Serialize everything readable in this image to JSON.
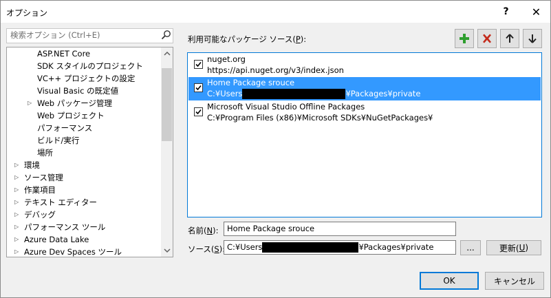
{
  "window": {
    "title": "オプション",
    "help": "?",
    "close": "✕"
  },
  "search": {
    "placeholder": "検索オプション (Ctrl+E)"
  },
  "tree": {
    "items": [
      {
        "label": "ASP.NET Core"
      },
      {
        "label": "SDK スタイルのプロジェクト"
      },
      {
        "label": "VC++ プロジェクトの設定"
      },
      {
        "label": "Visual Basic の既定値"
      },
      {
        "label": "Web パッケージ管理"
      },
      {
        "label": "Web プロジェクト"
      },
      {
        "label": "パフォーマンス"
      },
      {
        "label": "ビルド/実行"
      },
      {
        "label": "場所"
      },
      {
        "label": "環境"
      },
      {
        "label": "ソース管理"
      },
      {
        "label": "作業項目"
      },
      {
        "label": "テキスト エディター"
      },
      {
        "label": "デバッグ"
      },
      {
        "label": "パフォーマンス ツール"
      },
      {
        "label": "Azure Data Lake"
      },
      {
        "label": "Azure Dev Spaces ツール"
      }
    ]
  },
  "sources_panel": {
    "label_prefix": "利用可能なパッケージ ソース(",
    "label_key": "P",
    "label_suffix": "):",
    "items": [
      {
        "name": "nuget.org",
        "url": "https://api.nuget.org/v3/index.json",
        "url_tail": "",
        "checked": true
      },
      {
        "name": "Home Package srouce",
        "url": "C:¥Users",
        "url_tail": "¥Packages¥private",
        "checked": true
      },
      {
        "name": "Microsoft Visual Studio Offline Packages",
        "url": "C:¥Program Files (x86)¥Microsoft SDKs¥NuGetPackages¥",
        "url_tail": "",
        "checked": true
      }
    ]
  },
  "form": {
    "name_label_prefix": "名前(",
    "name_label_key": "N",
    "name_label_suffix": "):",
    "name_value": "Home Package srouce",
    "source_label_prefix": "ソース(",
    "source_label_key": "S",
    "source_label_suffix": "):",
    "source_value_prefix": "C:¥Users",
    "source_value_suffix": "¥Packages¥private",
    "browse_label": "...",
    "update_label_prefix": "更新(",
    "update_label_key": "U",
    "update_label_suffix": ")"
  },
  "footer": {
    "ok_label": "OK",
    "cancel_label": "キャンセル"
  },
  "colors": {
    "accent": "#0078d7",
    "selection": "#3399ff",
    "add": "#2e9e2e",
    "remove": "#c42b1c"
  }
}
